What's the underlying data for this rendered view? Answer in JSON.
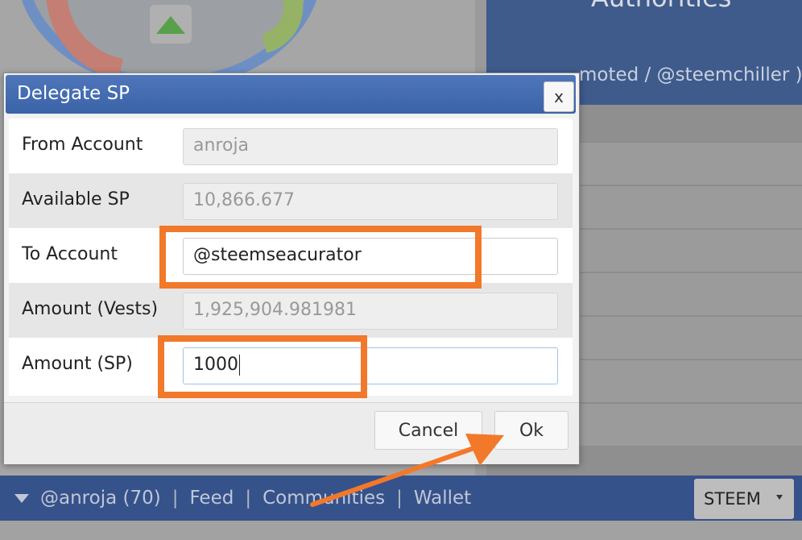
{
  "background": {
    "panel_title": "Authorities",
    "panel_subtitle": "moted / @steemchiller )"
  },
  "dialog": {
    "title": "Delegate SP",
    "close_label": "x",
    "fields": [
      {
        "label": "From Account",
        "value": "anroja"
      },
      {
        "label": "Available SP",
        "value": "10,866.677"
      },
      {
        "label": "To Account",
        "value": "@steemseacurator"
      },
      {
        "label": "Amount (Vests)",
        "value": "1,925,904.981981"
      },
      {
        "label": "Amount (SP)",
        "value": "1000"
      }
    ],
    "cancel_label": "Cancel",
    "ok_label": "Ok"
  },
  "nav": {
    "user": "@anroja (70)",
    "sep1": "|",
    "feed": "Feed",
    "sep2": "|",
    "communities": "Communities",
    "sep3": "|",
    "wallet": "Wallet",
    "currency_selected": "STEEM"
  },
  "colors": {
    "annotation": "#f2782a",
    "header_blue": "#3f68ae"
  }
}
